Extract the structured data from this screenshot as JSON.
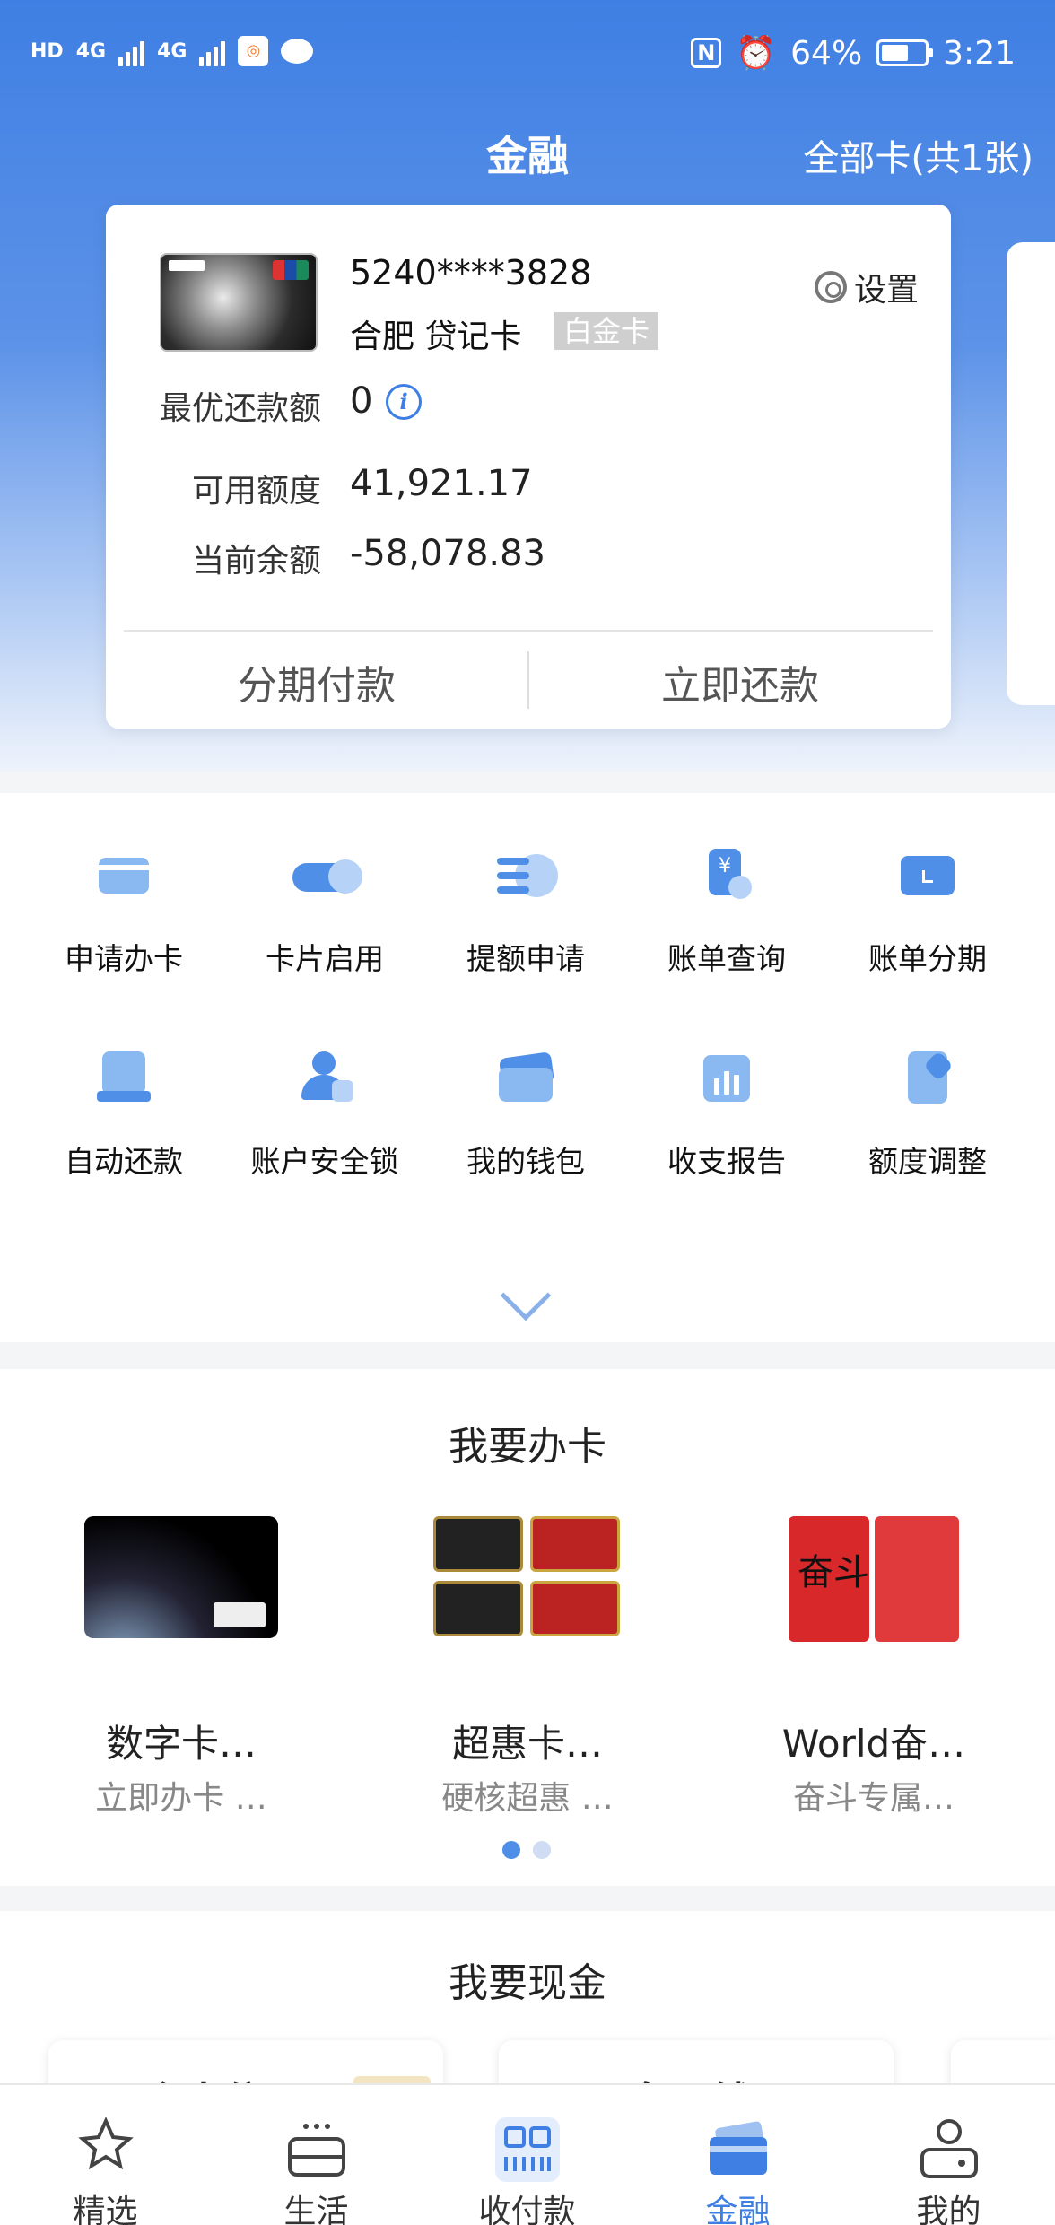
{
  "status_bar": {
    "network": "4G",
    "nfc_label": "N",
    "battery_percent": "64%",
    "battery_level": 0.64,
    "time": "3:21"
  },
  "header": {
    "title": "金融",
    "all_cards": "全部卡(共1张)"
  },
  "card": {
    "number": "5240****3828",
    "type": "合肥 贷记卡",
    "tier": "白金卡",
    "settings_label": "设置",
    "rows": [
      {
        "label": "最优还款额",
        "value": "0"
      },
      {
        "label": "可用额度",
        "value": "41,921.17"
      },
      {
        "label": "当前余额",
        "value": "-58,078.83"
      }
    ],
    "actions": {
      "installment": "分期付款",
      "repay": "立即还款"
    }
  },
  "services": [
    {
      "label": "申请办卡",
      "icon": "apply-card-icon"
    },
    {
      "label": "卡片启用",
      "icon": "activate-card-icon"
    },
    {
      "label": "提额申请",
      "icon": "limit-increase-icon"
    },
    {
      "label": "账单查询",
      "icon": "bill-query-icon"
    },
    {
      "label": "账单分期",
      "icon": "bill-installment-icon"
    },
    {
      "label": "自动还款",
      "icon": "auto-repay-icon"
    },
    {
      "label": "账户安全锁",
      "icon": "account-lock-icon"
    },
    {
      "label": "我的钱包",
      "icon": "wallet-icon"
    },
    {
      "label": "收支报告",
      "icon": "report-icon"
    },
    {
      "label": "额度调整",
      "icon": "limit-adjust-icon"
    }
  ],
  "apply_section": {
    "title": "我要办卡",
    "cards": [
      {
        "name": "数字卡…",
        "sub": "立即办卡 …"
      },
      {
        "name": "超惠卡…",
        "sub": "硬核超惠 …"
      },
      {
        "name": "World奋…",
        "sub": "奋斗专属…"
      }
    ],
    "active_page": 1,
    "page_count": 2
  },
  "cash_section": {
    "title": "我要现金",
    "cards": [
      {
        "title": "个人信用"
      },
      {
        "title": "备用钱"
      }
    ]
  },
  "tabbar": [
    {
      "label": "精选",
      "icon": "featured-icon"
    },
    {
      "label": "生活",
      "icon": "life-icon"
    },
    {
      "label": "收付款",
      "icon": "scan-pay-icon"
    },
    {
      "label": "金融",
      "icon": "finance-card-icon",
      "active": true
    },
    {
      "label": "我的",
      "icon": "profile-icon"
    }
  ],
  "colors": {
    "brand_blue": "#3f7fe3",
    "icon_light_blue": "#8ab8f0",
    "tab_active": "#3f7fe3"
  }
}
